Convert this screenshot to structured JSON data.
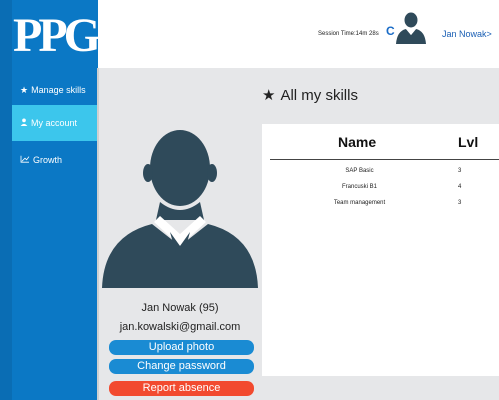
{
  "logo": {
    "text": "PPG"
  },
  "sidebar": {
    "items": [
      {
        "icon": "star-icon",
        "glyph": "★",
        "label": "Manage skills"
      },
      {
        "icon": "user-icon",
        "glyph": "👤",
        "label": "My account"
      },
      {
        "icon": "chart-icon",
        "glyph": "⟋",
        "label": "Growth"
      }
    ]
  },
  "header": {
    "session_time": "Session Time:14m 28s",
    "user_link": "Jan Nowak>"
  },
  "main": {
    "section_title": "All my skills"
  },
  "profile": {
    "name": "Jan Nowak (95)",
    "email": "jan.kowalski@gmail.com",
    "upload_label": "Upload photo",
    "change_password_label": "Change password",
    "report_absence_label": "Report absence"
  },
  "skills_table": {
    "headers": {
      "name": "Name",
      "lvl": "Lvl"
    },
    "rows": [
      {
        "name": "SAP Basic",
        "lvl": "3"
      },
      {
        "name": "Francuski B1",
        "lvl": "4"
      },
      {
        "name": "Team management",
        "lvl": "3"
      }
    ]
  },
  "colors": {
    "sidebar": "#0b78c5",
    "active_item": "#3cc6ec",
    "button_blue": "#1a8bd3",
    "button_red": "#f24a2f",
    "avatar": "#2f4a5a"
  }
}
